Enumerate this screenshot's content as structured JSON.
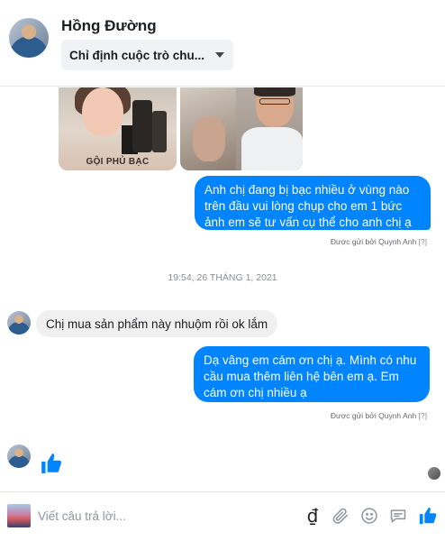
{
  "header": {
    "contact_name": "Hồng Đường",
    "assign_label": "Chỉ định cuộc trò chu..."
  },
  "thread": {
    "images": [
      {
        "caption": "GỘI PHỦ BẠC"
      },
      {
        "caption": ""
      }
    ],
    "messages": [
      {
        "direction": "outgoing",
        "text": "Anh chị đang   bị bạc nhiều ở vùng nào trên đầu vui lòng chụp cho em 1 bức ảnh em sẽ tư vấn cụ thể cho anh chị ạ"
      },
      {
        "direction": "incoming",
        "text": "Chị mua sản phẩm này nhuộm rồi ok  lắm"
      },
      {
        "direction": "outgoing",
        "text": "Dạ vâng em cám ơn chị ạ. Mình có nhu cầu mua thêm liên hệ bên em ạ. Em cám ơn chị nhiều ạ"
      }
    ],
    "sent_by_prefix": "Được gửi bởi",
    "sent_by_name": "Quynh Anh",
    "seen_marker": "[?]",
    "timestamp": "19:54, 26 THÁNG 1, 2021"
  },
  "composer": {
    "placeholder": "Viết câu trả lời...",
    "currency_symbol": "₫"
  },
  "colors": {
    "outgoing_bubble": "#0084ff",
    "incoming_bubble": "#f0f0f0",
    "like_blue": "#0084ff"
  },
  "icons": [
    "image-icon",
    "currency-icon",
    "attach-icon",
    "emoji-icon",
    "sticker-chat-icon",
    "thumbs-up-icon"
  ]
}
